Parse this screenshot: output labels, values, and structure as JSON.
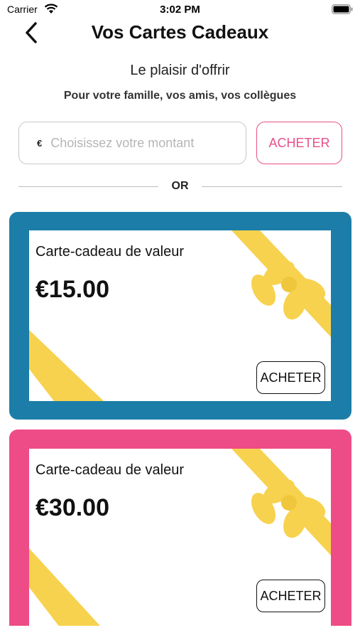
{
  "status_bar": {
    "carrier": "Carrier",
    "time": "3:02 PM"
  },
  "nav": {
    "title": "Vos Cartes Cadeaux",
    "back_icon": "chevron-left-icon"
  },
  "header": {
    "subtitle": "Le plaisir d'offrir",
    "caption": "Pour votre famille, vos amis, vos collègues"
  },
  "amount_form": {
    "currency_symbol": "€",
    "placeholder": "Choisissez votre montant",
    "value": "",
    "buy_label": "ACHETER"
  },
  "divider": {
    "label": "OR"
  },
  "colors": {
    "accent_pink": "#e8508a",
    "card_blue": "#1c7ea8",
    "card_pink": "#ee4c86",
    "ribbon_yellow": "#f7d24e"
  },
  "gift_cards": [
    {
      "label": "Carte-cadeau de valeur",
      "value": "€15.00",
      "buy_label": "ACHETER",
      "frame_color": "#1c7ea8"
    },
    {
      "label": "Carte-cadeau de valeur",
      "value": "€30.00",
      "buy_label": "ACHETER",
      "frame_color": "#ee4c86"
    }
  ]
}
